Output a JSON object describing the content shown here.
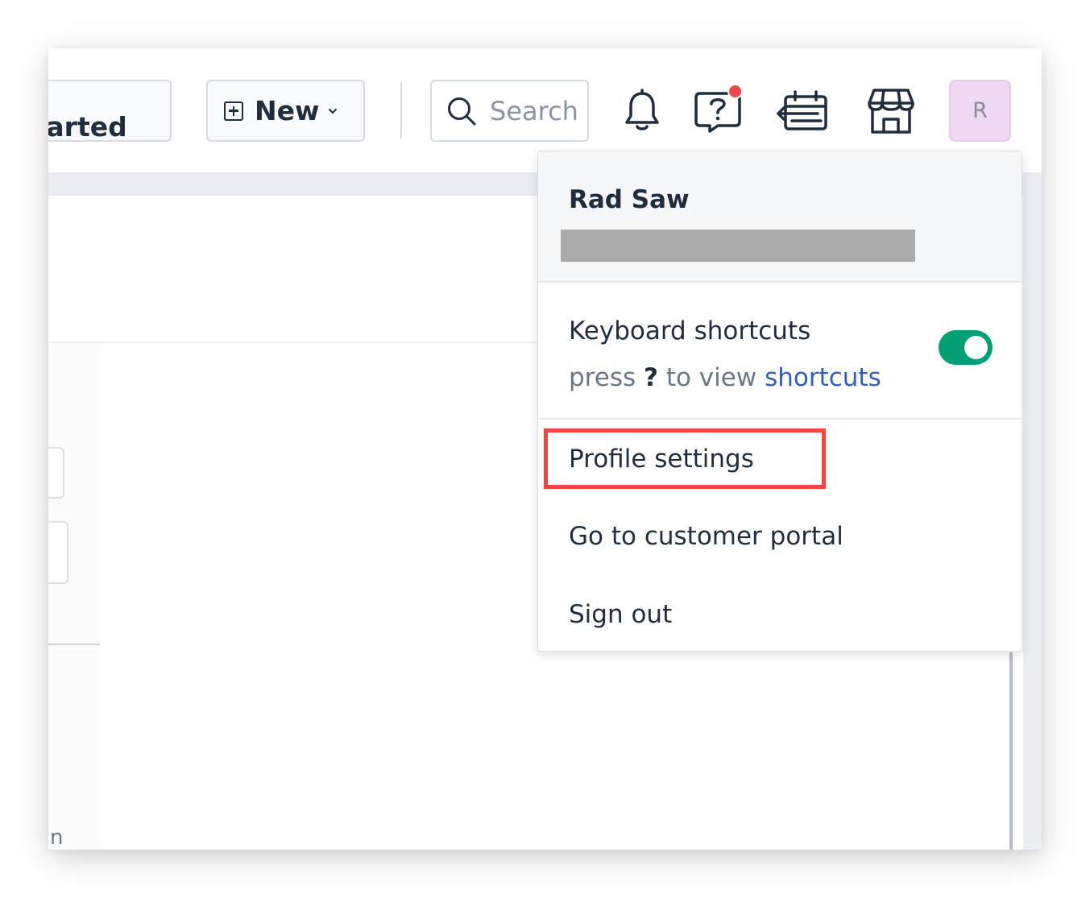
{
  "header": {
    "get_started_label": "t started",
    "new_label": "New",
    "search_placeholder": "Search",
    "avatar_initial": "R"
  },
  "icons": {
    "new": "plus-square-icon",
    "new_chevron": "chevron-down-icon",
    "search": "search-icon",
    "notifications": "bell-icon",
    "help": "help-question-icon",
    "changelog": "calendar-arrow-icon",
    "marketplace": "store-icon"
  },
  "background": {
    "fragment_text": "n"
  },
  "menu": {
    "user_name": "Rad Saw",
    "keyboard_shortcuts_label": "Keyboard shortcuts",
    "hint_prefix": "press",
    "hint_key": "?",
    "hint_middle": "to view",
    "hint_link": "shortcuts",
    "keyboard_shortcuts_enabled": true,
    "items": [
      {
        "label": "Profile settings"
      },
      {
        "label": "Go to customer portal"
      },
      {
        "label": "Sign out"
      }
    ]
  },
  "colors": {
    "toggle_on": "#00a074",
    "link": "#2f5fc0",
    "notification_dot": "#f0474a",
    "highlight": "#f2453d",
    "avatar_bg": "#eed8f3"
  }
}
